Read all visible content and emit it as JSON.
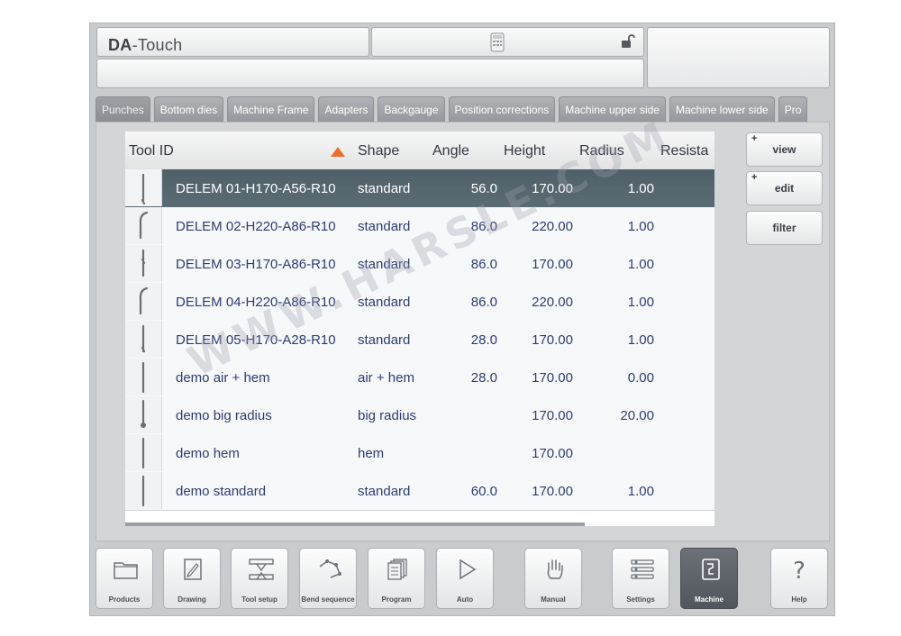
{
  "header": {
    "logo_bold": "DA",
    "logo_rest": "-Touch"
  },
  "tabs": [
    {
      "label": "Punches",
      "active": true
    },
    {
      "label": "Bottom dies"
    },
    {
      "label": "Machine Frame"
    },
    {
      "label": "Adapters"
    },
    {
      "label": "Backgauge"
    },
    {
      "label": "Position corrections"
    },
    {
      "label": "Machine upper side"
    },
    {
      "label": "Machine lower side"
    },
    {
      "label": "Pro"
    }
  ],
  "table": {
    "columns": [
      "Tool ID",
      "Shape",
      "Angle",
      "Height",
      "Radius",
      "Resista"
    ],
    "rows": [
      {
        "id": "DELEM 01-H170-A56-R10",
        "shape": "standard",
        "angle": "56.0",
        "height": "170.00",
        "radius": "1.00",
        "selected": true
      },
      {
        "id": "DELEM 02-H220-A86-R10",
        "shape": "standard",
        "angle": "86.0",
        "height": "220.00",
        "radius": "1.00"
      },
      {
        "id": "DELEM 03-H170-A86-R10",
        "shape": "standard",
        "angle": "86.0",
        "height": "170.00",
        "radius": "1.00"
      },
      {
        "id": "DELEM 04-H220-A86-R10",
        "shape": "standard",
        "angle": "86.0",
        "height": "220.00",
        "radius": "1.00"
      },
      {
        "id": "DELEM 05-H170-A28-R10",
        "shape": "standard",
        "angle": "28.0",
        "height": "170.00",
        "radius": "1.00"
      },
      {
        "id": "demo air + hem",
        "shape": "air + hem",
        "angle": "28.0",
        "height": "170.00",
        "radius": "0.00"
      },
      {
        "id": "demo big radius",
        "shape": "big radius",
        "angle": "",
        "height": "170.00",
        "radius": "20.00"
      },
      {
        "id": "demo hem",
        "shape": "hem",
        "angle": "",
        "height": "170.00",
        "radius": ""
      },
      {
        "id": "demo standard",
        "shape": "standard",
        "angle": "60.0",
        "height": "170.00",
        "radius": "1.00"
      }
    ]
  },
  "side_buttons": {
    "view": "view",
    "edit": "edit",
    "filter": "filter",
    "plus": "+"
  },
  "nav": [
    {
      "label": "Products",
      "icon": "folder-icon"
    },
    {
      "label": "Drawing",
      "icon": "drawing-icon"
    },
    {
      "label": "Tool setup",
      "icon": "tool-setup-icon"
    },
    {
      "label": "Bend sequence",
      "icon": "bend-sequence-icon"
    },
    {
      "label": "Program",
      "icon": "program-icon"
    },
    {
      "label": "Auto",
      "icon": "play-icon"
    },
    {
      "label": "Manual",
      "icon": "hand-icon"
    },
    {
      "label": "Settings",
      "icon": "settings-icon"
    },
    {
      "label": "Machine",
      "icon": "machine-icon",
      "active": true
    },
    {
      "label": "Help",
      "icon": "help-icon"
    }
  ],
  "help_glyph": "?",
  "watermark": "WWW.HARSLE.COM",
  "colors": {
    "selected_row": "#55656d",
    "sort_arrow": "#e8702a",
    "row_text": "#2d3c73"
  }
}
